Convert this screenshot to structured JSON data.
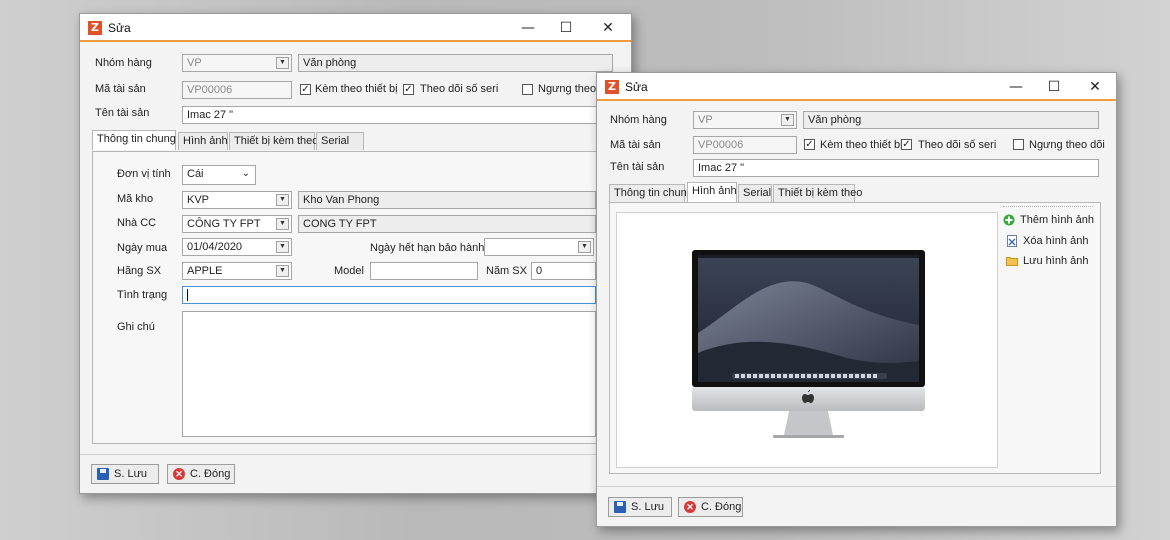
{
  "left_window": {
    "title": "Sửa",
    "controls": {
      "minimize": "—",
      "maximize": "☐",
      "close": "✕"
    },
    "nhom_hang_label": "Nhóm hàng",
    "nhom_hang_code": "VP",
    "nhom_hang_name": "Văn phòng",
    "ma_tai_san_label": "Mã tài sản",
    "ma_tai_san_value": "VP00006",
    "kem_theo_thiet_bi": "Kèm theo thiết bị",
    "theo_doi_so_seri": "Theo dõi số seri",
    "ngung_theo_doi": "Ngưng theo d",
    "ten_tai_san_label": "Tên tài sản",
    "ten_tai_san_value": "Imac 27 \"",
    "tabs": [
      "Thông tin chung",
      "Hình ảnh",
      "Thiết bị kèm theo",
      "Serial"
    ],
    "don_vi_tinh_label": "Đơn vị tính",
    "don_vi_tinh_value": "Cái",
    "ma_kho_label": "Mã kho",
    "ma_kho_code": "KVP",
    "ma_kho_name": "Kho Van Phong",
    "nha_cc_label": "Nhà CC",
    "nha_cc_code": "CÔNG TY FPT",
    "nha_cc_name": "CONG TY FPT",
    "ngay_mua_label": "Ngày mua",
    "ngay_mua_value": "01/04/2020",
    "ngay_het_han_label": "Ngày hết hạn bảo hành",
    "ngay_het_han_value": "",
    "hang_sx_label": "Hãng SX",
    "hang_sx_value": "APPLE",
    "model_label": "Model",
    "model_value": "",
    "nam_sx_label": "Năm SX",
    "nam_sx_value": "0",
    "tinh_trang_label": "Tình trạng",
    "tinh_trang_value": "",
    "ghi_chu_label": "Ghi chú",
    "ghi_chu_value": "",
    "save_button": "S. Lưu",
    "close_button": "C. Đóng"
  },
  "right_window": {
    "title": "Sửa",
    "controls": {
      "minimize": "—",
      "maximize": "☐",
      "close": "✕"
    },
    "nhom_hang_label": "Nhóm hàng",
    "nhom_hang_code": "VP",
    "nhom_hang_name": "Văn phòng",
    "ma_tai_san_label": "Mã tài sản",
    "ma_tai_san_value": "VP00006",
    "kem_theo_thiet_bi": "Kèm theo thiết bị",
    "theo_doi_so_seri": "Theo dõi số seri",
    "ngung_theo_doi": "Ngưng theo dõi",
    "ten_tai_san_label": "Tên tài sản",
    "ten_tai_san_value": "Imac 27 \"",
    "tabs": [
      "Thông tin chung",
      "Hình ảnh",
      "Serial",
      "Thiết bị kèm theo"
    ],
    "them_hinh_anh": "Thêm hình ảnh",
    "xoa_hinh_anh": "Xóa hình ảnh",
    "luu_hinh_anh": "Lưu hình ảnh",
    "save_button": "S. Lưu",
    "close_button": "C. Đóng"
  },
  "colors": {
    "accent": "#f39a3c",
    "focus": "#4a90d9",
    "brand": "#e2502a"
  },
  "icons": {
    "app": "z-logo-icon",
    "add": "plus-circle-icon",
    "delete": "delete-doc-icon",
    "save_image": "folder-icon"
  }
}
